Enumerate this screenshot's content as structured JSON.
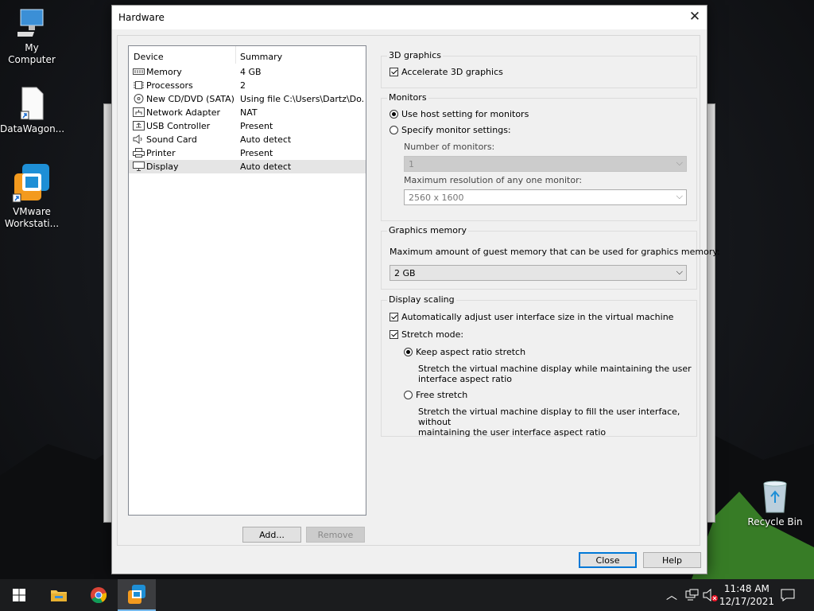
{
  "desktop": {
    "icons": [
      {
        "label": "My Computer"
      },
      {
        "label": "DataWagon..."
      },
      {
        "label": "VMware Workstati..."
      },
      {
        "label": "Recycle Bin"
      }
    ]
  },
  "dialog": {
    "title": "Hardware",
    "device_list": {
      "header_device": "Device",
      "header_summary": "Summary",
      "rows": [
        {
          "device": "Memory",
          "summary": "4 GB",
          "icon": "memory-icon"
        },
        {
          "device": "Processors",
          "summary": "2",
          "icon": "processor-icon"
        },
        {
          "device": "New CD/DVD (SATA)",
          "summary": "Using file C:\\Users\\Dartz\\Do...",
          "icon": "cd-icon"
        },
        {
          "device": "Network Adapter",
          "summary": "NAT",
          "icon": "network-icon"
        },
        {
          "device": "USB Controller",
          "summary": "Present",
          "icon": "usb-icon"
        },
        {
          "device": "Sound Card",
          "summary": "Auto detect",
          "icon": "sound-icon"
        },
        {
          "device": "Printer",
          "summary": "Present",
          "icon": "printer-icon"
        },
        {
          "device": "Display",
          "summary": "Auto detect",
          "icon": "display-icon",
          "selected": true
        }
      ]
    },
    "add_button": "Add...",
    "remove_button": "Remove",
    "graphics3d": {
      "title": "3D graphics",
      "accelerate_label": "Accelerate 3D graphics",
      "accelerate_checked": true
    },
    "monitors": {
      "title": "Monitors",
      "use_host_label": "Use host setting for monitors",
      "specify_label": "Specify monitor settings:",
      "selected": "use_host",
      "num_monitors_label": "Number of monitors:",
      "num_monitors_value": "1",
      "max_res_label": "Maximum resolution of any one monitor:",
      "max_res_value": "2560 x 1600"
    },
    "graphics_memory": {
      "title": "Graphics memory",
      "label": "Maximum amount of guest memory that can be used for graphics memory:",
      "value": "2 GB"
    },
    "display_scaling": {
      "title": "Display scaling",
      "auto_adjust_label": "Automatically adjust user interface size in the virtual machine",
      "auto_adjust_checked": true,
      "stretch_label": "Stretch mode:",
      "stretch_checked": true,
      "keep_aspect_label": "Keep aspect ratio stretch",
      "keep_aspect_desc_1": "Stretch the virtual machine display while maintaining the user",
      "keep_aspect_desc_2": "interface aspect ratio",
      "free_label": "Free stretch",
      "free_desc_1": "Stretch the virtual machine display to fill the user interface, without",
      "free_desc_2": "maintaining the user interface aspect ratio",
      "selected": "keep_aspect"
    },
    "close_button": "Close",
    "help_button": "Help"
  },
  "taskbar": {
    "time": "11:48 AM",
    "date": "12/17/2021"
  },
  "colors": {
    "accent": "#0078d7",
    "taskbar": "#1b1c1e",
    "dialog_bg": "#f0f0f0"
  }
}
